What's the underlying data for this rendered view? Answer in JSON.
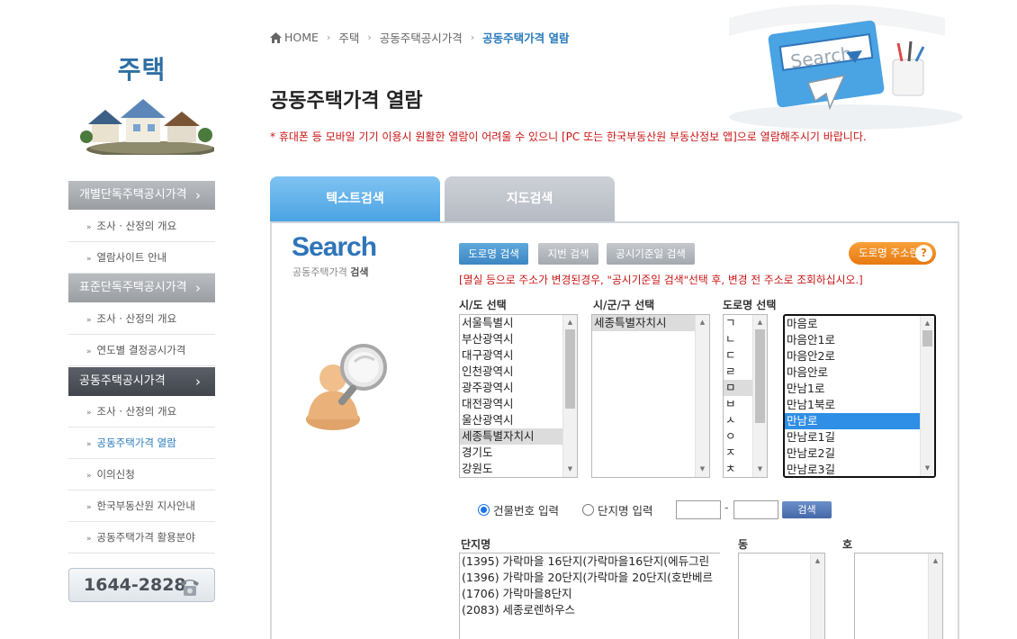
{
  "sidebar": {
    "title": "주택",
    "menus": [
      {
        "label": "개별단독주택공시가격",
        "arrow": "›"
      },
      {
        "label": "표준단독주택공시가격",
        "arrow": "›"
      },
      {
        "label": "공동주택공시가격",
        "arrow": "›"
      }
    ],
    "items_individual": [
      "조사 · 산정의 개요",
      "열람사이트 안내"
    ],
    "items_standard": [
      "조사 · 산정의 개요",
      "연도별 결정공시가격"
    ],
    "items_apartment": [
      "조사 · 산정의 개요",
      "공동주택가격 열람",
      "이의신청",
      "한국부동산원 지사안내",
      "공동주택가격 활용분야"
    ],
    "bullet": "»",
    "phone": "1644-2828"
  },
  "breadcrumb": {
    "home": "HOME",
    "items": [
      "주택",
      "공동주택공시가격",
      "공동주택가격 열람"
    ],
    "sep": "›"
  },
  "page": {
    "title": "공동주택가격 열람",
    "notice": "* 휴대폰 등 모바일 기기 이용시 원활한 열람이 어려울 수 있으니 [PC 또는 한국부동산원 부동산정보 앱]으로 열람해주시기 바랍니다."
  },
  "hero": {
    "search_text": "Search"
  },
  "tabs": {
    "text_search": "텍스트검색",
    "map_search": "지도검색"
  },
  "search_panel": {
    "logo": "Search",
    "sub_plain": "공동주택가격 ",
    "sub_bold": "검색",
    "buttons": {
      "road": "도로명 검색",
      "jibun": "지번 검색",
      "notice_date": "공시기준일 검색",
      "road_dict": "도로명 주소란",
      "road_dict_q": "?"
    },
    "warning": "[멸실 등으로 주소가 변경된경우, \"공시기준일 검색\"선택 후, 변경 전 주소로 조회하십시오.]",
    "labels": {
      "sido": "시/도 선택",
      "sigungu": "시/군/구 선택",
      "road": "도로명 선택"
    },
    "sido_options": [
      "서울특별시",
      "부산광역시",
      "대구광역시",
      "인천광역시",
      "광주광역시",
      "대전광역시",
      "울산광역시",
      "세종특별자치시",
      "경기도",
      "강원도"
    ],
    "sido_selected": "세종특별자치시",
    "sigungu_options": [
      "세종특별자치시"
    ],
    "initial_options": [
      "ㄱ",
      "ㄴ",
      "ㄷ",
      "ㄹ",
      "ㅁ",
      "ㅂ",
      "ㅅ",
      "ㅇ",
      "ㅈ",
      "ㅊ"
    ],
    "initial_selected": "ㅁ",
    "road_options": [
      "마음로",
      "마음안1로",
      "마음안2로",
      "마음안로",
      "만남1로",
      "만남1북로",
      "만남로",
      "만남로1길",
      "만남로2길",
      "만남로3길"
    ],
    "road_selected": "만남로",
    "radio_building": "건물번호 입력",
    "radio_complex": "단지명 입력",
    "radio_checked": "building",
    "dash": "-",
    "search_button": "검색",
    "complex_label": "단지명",
    "dong_label": "동",
    "ho_label": "호",
    "complex_options": [
      "(1395) 가락마을 16단지(가락마을16단지(에듀그린",
      "(1396) 가락마을 20단지(가락마을 20단지(호반베르",
      "(1706) 가락마을8단지",
      "(2083) 세종로렌하우스"
    ]
  },
  "colors": {
    "accent_blue": "#2f74b8",
    "notice_red": "#c81414",
    "selected_blue": "#2f8ee5",
    "orange": "#e77a10"
  }
}
